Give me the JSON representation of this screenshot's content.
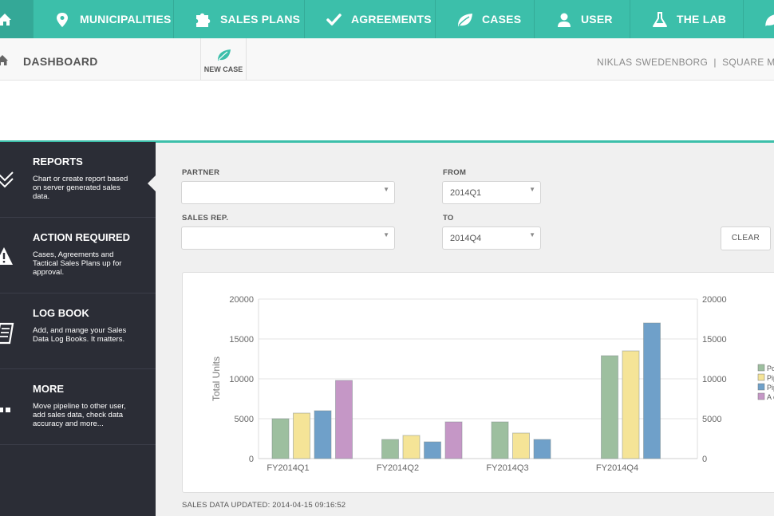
{
  "nav": {
    "home_icon": "home-icon",
    "items": [
      {
        "label": "MUNICIPALITIES",
        "icon": "map-marker-icon"
      },
      {
        "label": "SALES PLANS",
        "icon": "puzzle-icon"
      },
      {
        "label": "AGREEMENTS",
        "icon": "check-icon"
      },
      {
        "label": "CASES",
        "icon": "leaf-icon"
      },
      {
        "label": "USER",
        "icon": "user-icon"
      },
      {
        "label": "THE LAB",
        "icon": "flask-icon"
      }
    ]
  },
  "header": {
    "title": "DASHBOARD",
    "new_case_label": "NEW CASE",
    "user_info": "NIKLAS SWEDENBORG  |  SQUARE MOO"
  },
  "sidebar": {
    "items": [
      {
        "title": "REPORTS",
        "desc": "Chart or create report based on server generated sales data.",
        "icon": "check-chevrons-icon"
      },
      {
        "title": "ACTION REQUIRED",
        "desc": "Cases, Agreements and Tactical Sales Plans up for approval.",
        "icon": "warning-icon"
      },
      {
        "title": "LOG BOOK",
        "desc": "Add, and mange your Sales Data Log Books. It matters.",
        "icon": "logbook-icon"
      },
      {
        "title": "MORE",
        "desc": "Move pipeline to other user, add sales data, check data accuracy and more...",
        "icon": "more-dots-icon"
      }
    ]
  },
  "filters": {
    "partner_label": "PARTNER",
    "partner_value": "",
    "sales_rep_label": "SALES REP.",
    "sales_rep_value": "",
    "from_label": "FROM",
    "from_value": "2014Q1",
    "to_label": "TO",
    "to_value": "2014Q4",
    "clear_label": "CLEAR"
  },
  "chart_data": {
    "type": "bar",
    "categories": [
      "FY2014Q1",
      "FY2014Q2",
      "FY2014Q3",
      "FY2014Q4"
    ],
    "series": [
      {
        "name": "Po",
        "color": "#9dbf9f",
        "values": [
          5000,
          2400,
          4600,
          12900
        ]
      },
      {
        "name": "Pip",
        "color": "#f5e497",
        "values": [
          5700,
          2900,
          3200,
          13500
        ]
      },
      {
        "name": "Pip",
        "color": "#6fa0c9",
        "values": [
          6000,
          2100,
          2400,
          17000
        ]
      },
      {
        "name": "A c",
        "color": "#c597c6",
        "values": [
          9800,
          4600,
          null,
          null
        ]
      }
    ],
    "ylabel": "Total Units",
    "ylim": [
      0,
      20000
    ],
    "yticks": [
      "20000",
      "15000",
      "10000",
      "5000",
      "0"
    ],
    "grid": true,
    "legend": "right"
  },
  "footer": {
    "updated": "SALES DATA UPDATED: 2014-04-15 09:16:52"
  }
}
